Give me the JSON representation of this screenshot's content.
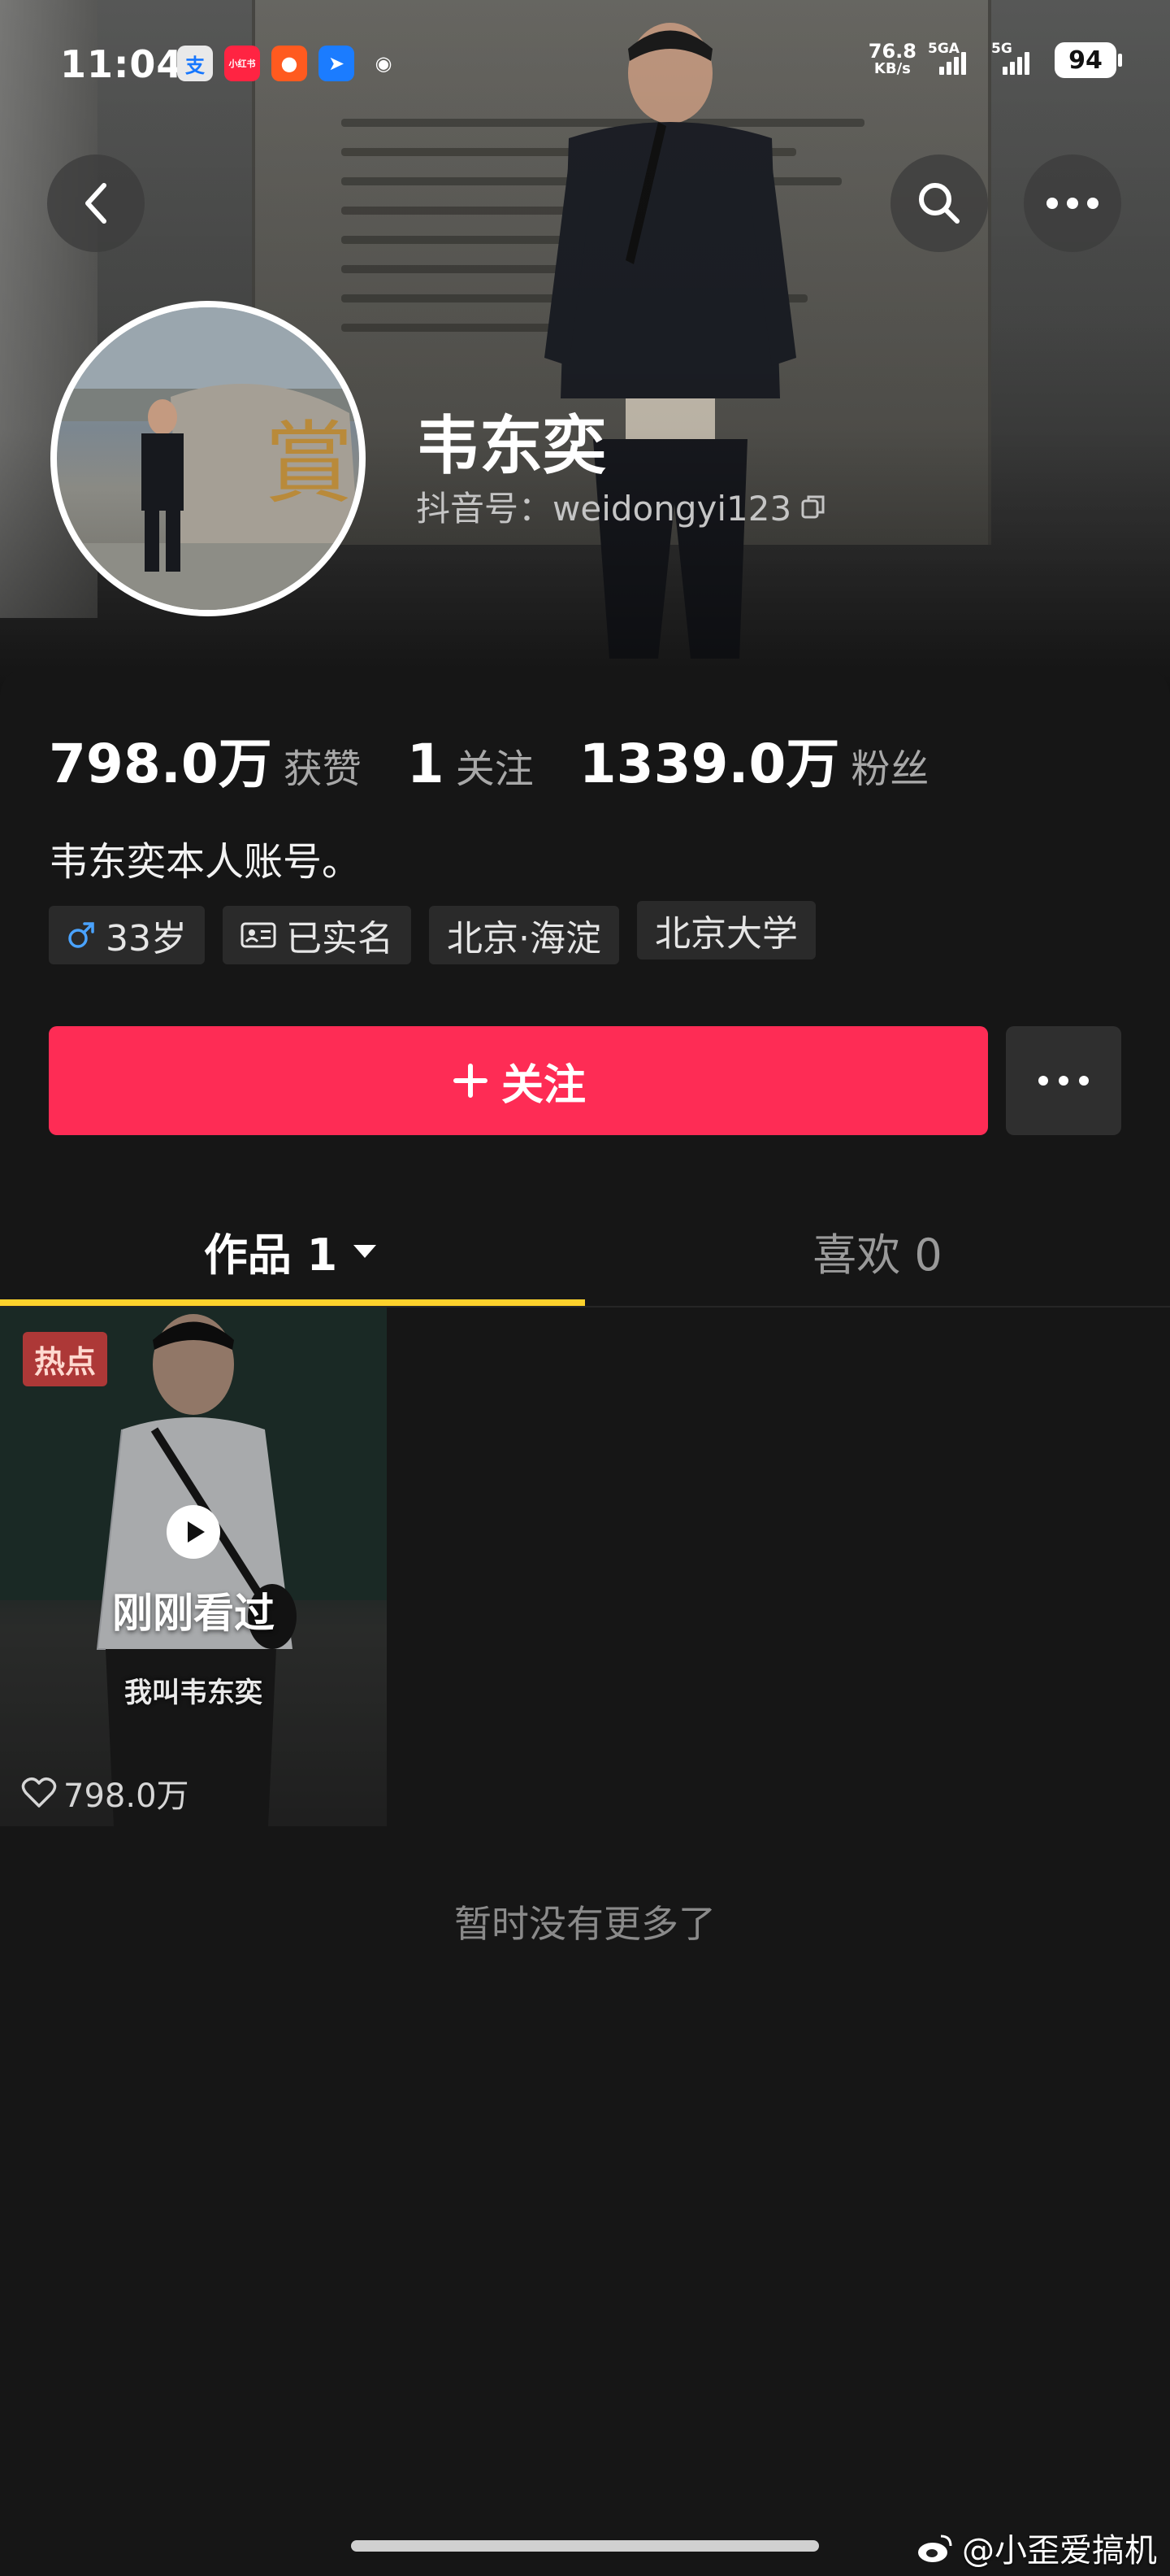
{
  "status_bar": {
    "time": "11:04",
    "apps": [
      {
        "icon": "alipay-icon",
        "glyph": "支",
        "color": "#e9e9e9",
        "text_color": "#1677ff"
      },
      {
        "icon": "xiaohongshu-icon",
        "glyph": "小红书",
        "color": "#ff2442",
        "text_color": "#ffffff"
      },
      {
        "icon": "news-app-icon",
        "glyph": "●",
        "color": "#ff5a1f",
        "text_color": "#ffffff"
      },
      {
        "icon": "navigation-app-icon",
        "glyph": "➤",
        "color": "#1b7cff",
        "text_color": "#ffffff"
      },
      {
        "icon": "weibo-icon",
        "glyph": "◉",
        "color": "transparent",
        "text_color": "#ffffff"
      }
    ],
    "net_speed": "76.8",
    "net_unit": "KB/s",
    "signal1_label": "5GA",
    "signal2_label": "5G",
    "battery": "94"
  },
  "profile": {
    "nickname": "韦东奕",
    "douyin_id": "抖音号：weidongyi123",
    "stats": [
      {
        "value": "798.0万",
        "label": "获赞"
      },
      {
        "value": "1",
        "label": "关注"
      },
      {
        "value": "1339.0万",
        "label": "粉丝"
      }
    ],
    "bio": "韦东奕本人账号。",
    "tags": {
      "age": "33岁",
      "verified": "已实名",
      "location": "北京·海淀",
      "school": "北京大学"
    },
    "follow_label": "关注"
  },
  "tabs": {
    "works": "作品 1",
    "likes": "喜欢 0"
  },
  "video": {
    "badge": "热点",
    "watched_label": "刚刚看过",
    "caption": "我叫韦东奕",
    "likes": "798.0万"
  },
  "footer": {
    "no_more": "暂时没有更多了",
    "watermark": "@小歪爱搞机"
  },
  "colors": {
    "accent": "#fe2c55",
    "tab_underline": "#fdd22c",
    "background": "#161616"
  }
}
